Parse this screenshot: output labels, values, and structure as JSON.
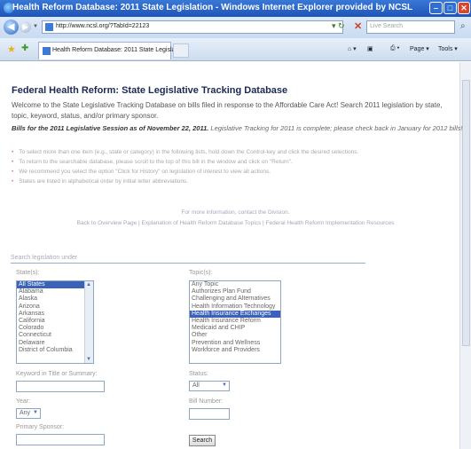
{
  "browser": {
    "window_title": "Health Reform Database: 2011 State Legislation - Windows Internet Explorer provided by NCSL",
    "url": "http://www.ncsl.org/?TabId=22123",
    "search_placeholder": "Live Search",
    "tab_title": "Health Reform Database: 2011 State Legislation",
    "toolbar": {
      "page_label": "Page",
      "tools_label": "Tools"
    }
  },
  "page": {
    "heading": "Federal Health Reform: State Legislative Tracking Database",
    "intro": "Welcome to the State Legislative Tracking Database on bills filed in response to the Affordable Care Act! Search 2011 legislation by state, topic, keyword, status, and/or primary sponsor.",
    "session_bold": "Bills for the 2011 Legislative Session as of November 22, 2011.",
    "session_note": "Legislative Tracking for 2011 is complete; please check back in January for 2012 bills!",
    "bullets": [
      "To select more than one item (e.g., state or category) in the following lists, hold down the Control-key and click the desired selections.",
      "To return to the searchable database, please scroll to the top of this bill in the window and click on \"Return\".",
      "We recommend you select the option \"Click for History\" on legislation of interest to view all actions.",
      "States are listed in alphabetical order by initial letter abbreviations."
    ],
    "contact": "For more information, contact the Division.",
    "links": [
      "Back to Overview Page",
      "Explanation of Health Reform Database Topics",
      "Federal Health Reform Implementation Resources"
    ]
  },
  "form": {
    "legend": "Search legislation under",
    "states_label": "State(s):",
    "states": [
      "All States",
      "Alabama",
      "Alaska",
      "Arizona",
      "Arkansas",
      "California",
      "Colorado",
      "Connecticut",
      "Delaware",
      "District of Columbia"
    ],
    "states_selected": "All States",
    "topics_label": "Topic(s):",
    "topics": [
      "Any Topic",
      "Authorizes Plan Fund",
      "Challenging and Alternatives",
      "Health Information Technology",
      "Health Insurance Exchanges",
      "Health Insurance Reform",
      "Medicaid and CHIP",
      "Other",
      "Prevention and Wellness",
      "Workforce and Providers"
    ],
    "topics_selected": "Health Insurance Exchanges",
    "keyword_label": "Keyword in Title or Summary:",
    "status_label": "Status:",
    "status_value": "All",
    "year_label": "Year:",
    "year_value": "Any",
    "bill_label": "Bill Number:",
    "sponsor_label": "Primary Sponsor:",
    "search_button": "Search"
  },
  "colors": {
    "titlebar": "#1d55b8",
    "selection": "#3b62b9",
    "heading": "#1a2a55"
  }
}
